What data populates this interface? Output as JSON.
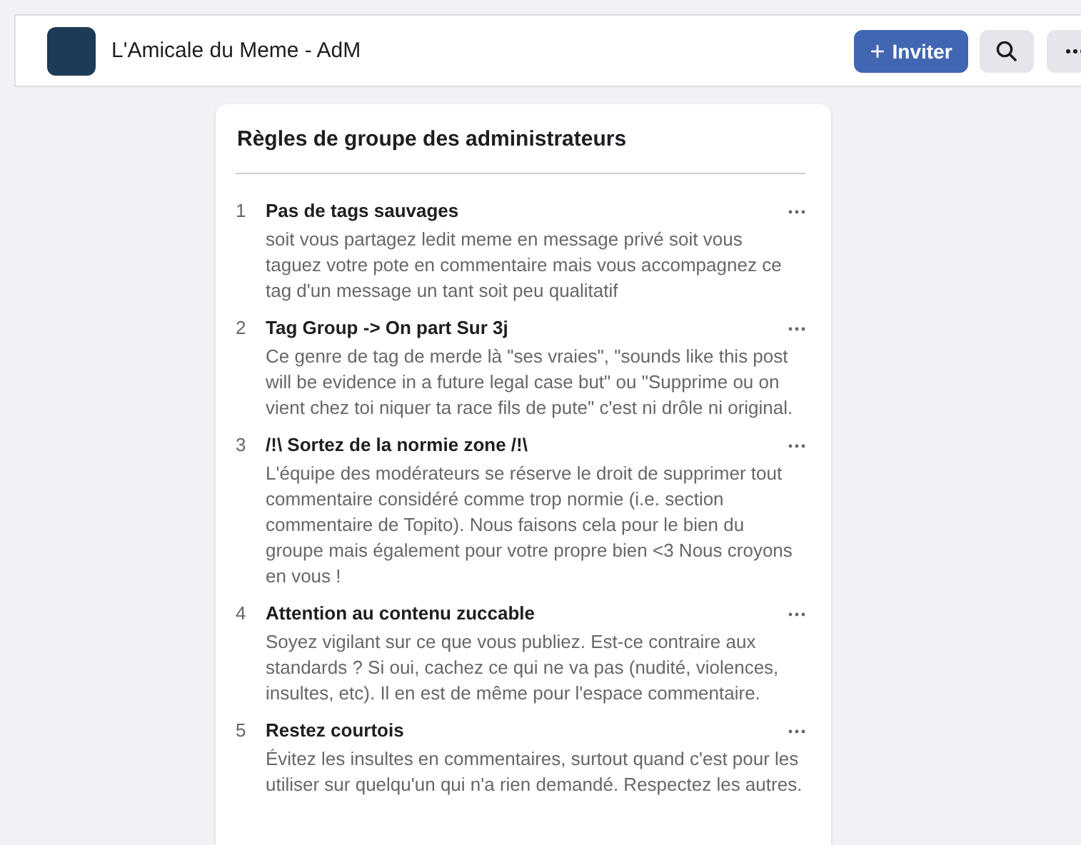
{
  "header": {
    "group_name": "L'Amicale du Meme - AdM",
    "invite_button": {
      "icon": "+",
      "label": "Inviter"
    }
  },
  "rules_card": {
    "title": "Règles de groupe des administrateurs",
    "rules": [
      {
        "number": "1",
        "title": "Pas de tags sauvages",
        "text": "soit vous partagez ledit meme en message privé soit vous taguez votre pote en commentaire mais vous accompagnez ce tag d'un message un tant soit peu qualitatif"
      },
      {
        "number": "2",
        "title": "Tag Group -> On part Sur 3j",
        "text": "Ce genre de tag de merde là \"ses vraies\", \"sounds like this post will be evidence in a future legal case but\" ou \"Supprime ou on vient chez toi niquer ta race fils de pute\" c'est ni drôle ni original."
      },
      {
        "number": "3",
        "title": "/!\\ Sortez de la normie zone /!\\",
        "text": "L'équipe des modérateurs se réserve le droit de supprimer tout commentaire considéré comme trop normie (i.e. section commentaire de Topito). Nous faisons cela pour le bien du groupe mais également pour votre propre bien <3 Nous croyons en vous !"
      },
      {
        "number": "4",
        "title": "Attention au contenu zuccable",
        "text": "Soyez vigilant sur ce que vous publiez. Est-ce contraire aux standards ? Si oui, cachez ce qui ne va pas (nudité, violences, insultes, etc). Il en est de même pour l'espace commentaire."
      },
      {
        "number": "5",
        "title": "Restez courtois",
        "text": "Évitez les insultes en commentaires, surtout quand c'est pour les utiliser sur quelqu'un qui n'a rien demandé. Respectez les autres."
      }
    ]
  }
}
